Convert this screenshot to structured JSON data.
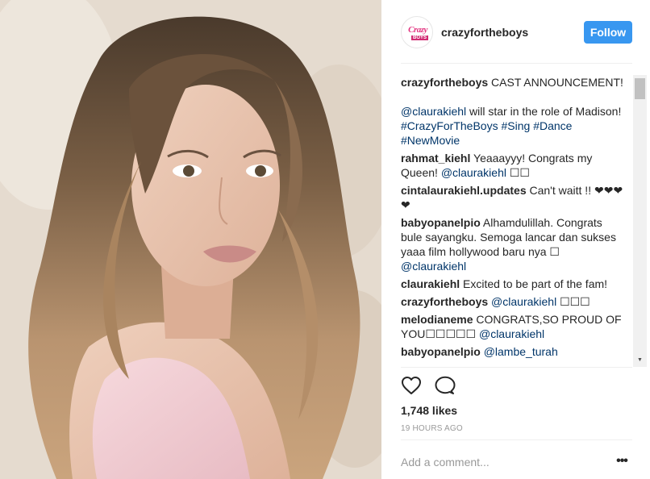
{
  "post": {
    "photo_alt": "Portrait photo",
    "author": {
      "avatar_line1": "Crazy",
      "avatar_line2": "BOYS",
      "username": "crazyfortheboys",
      "follow_label": "Follow"
    },
    "caption": {
      "username": "crazyfortheboys",
      "line1": "CAST ANNOUNCEMENT!",
      "mention": "@claurakiehl",
      "text": " will star in the role of Madison! ",
      "hashtags": [
        "#CrazyForTheBoys",
        "#Sing",
        "#Dance",
        "#NewMovie"
      ]
    },
    "comments": [
      {
        "username": "rahmat_kiehl",
        "text": "Yeaaayyy! Congrats my Queen! ",
        "mention": "@claurakiehl",
        "tail": " ☐☐"
      },
      {
        "username": "cintalaurakiehl.updates",
        "text": "Can't waitt !! ❤❤❤❤",
        "mention": "",
        "tail": ""
      },
      {
        "username": "babyopanelpio",
        "text": "Alhamdulillah. Congrats bule sayangku. Semoga lancar dan sukses yaaa film hollywood baru nya ☐ ",
        "mention": "@claurakiehl",
        "tail": ""
      },
      {
        "username": "claurakiehl",
        "text": "Excited to be part of the fam!",
        "mention": "",
        "tail": ""
      },
      {
        "username": "crazyfortheboys",
        "text": "",
        "mention": "@claurakiehl",
        "tail": " ☐☐☐"
      },
      {
        "username": "melodianeme",
        "text": "CONGRATS,SO PROUD OF YOU☐☐☐☐☐ ",
        "mention": "@claurakiehl",
        "tail": ""
      },
      {
        "username": "babyopanelpio",
        "text": "",
        "mention": "@lambe_turah",
        "tail": ""
      }
    ],
    "likes": "1,748 likes",
    "time": "19 HOURS AGO",
    "add_comment_placeholder": "Add a comment...",
    "more_label": "•••",
    "icons": [
      "heart-icon",
      "comment-icon",
      "ellipsis-icon"
    ],
    "colors": {
      "follow": "#3897f0",
      "mention": "#003569",
      "brand": "#e2337f"
    }
  }
}
